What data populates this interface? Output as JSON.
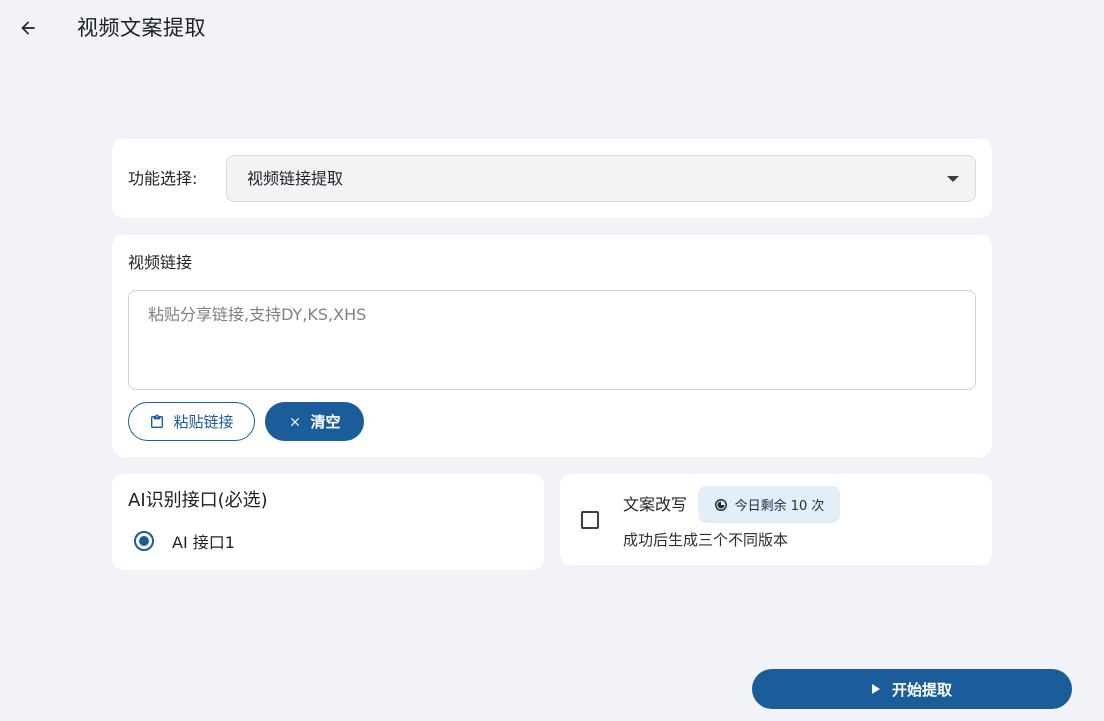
{
  "header": {
    "title": "视频文案提取",
    "back_icon": "arrow-left-icon"
  },
  "function_select": {
    "label": "功能选择:",
    "value": "视频链接提取"
  },
  "video_link": {
    "title": "视频链接",
    "placeholder": "粘贴分享链接,支持DY,KS,XHS",
    "value": "",
    "paste_button": "粘贴链接",
    "clear_button": "清空"
  },
  "ai_interface": {
    "title": "AI识别接口(必选)",
    "options": [
      {
        "label": "AI 接口1",
        "selected": true
      }
    ]
  },
  "rewrite": {
    "checked": false,
    "title": "文案改写",
    "quota": "今日剩余 10 次",
    "description": "成功后生成三个不同版本"
  },
  "start_button": "开始提取",
  "colors": {
    "background": "#f1f3f8",
    "card": "#ffffff",
    "primary": "#1b5c9b",
    "badge": "#e3eef9"
  }
}
